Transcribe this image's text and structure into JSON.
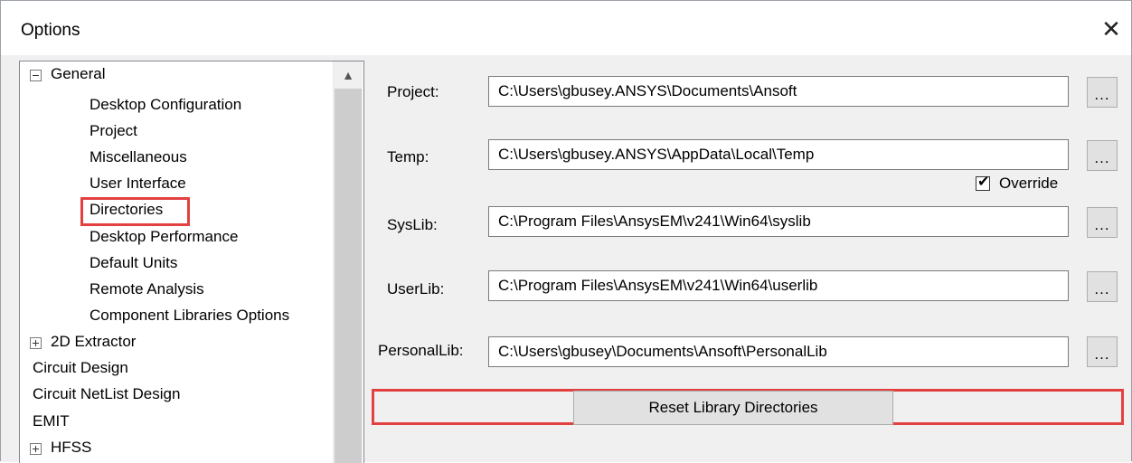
{
  "window": {
    "title": "Options"
  },
  "icons": {
    "close": "close-icon",
    "expand": "plus-box-icon",
    "collapse": "minus-box-icon",
    "scroll_up": "chevron-up-icon"
  },
  "tree": {
    "general": "General",
    "general_children": [
      "Desktop Configuration",
      "Project",
      "Miscellaneous",
      "User Interface",
      "Directories",
      "Desktop Performance",
      "Default Units",
      "Remote Analysis",
      "Component Libraries Options"
    ],
    "extractor_2d": "2D Extractor",
    "circuit_design": "Circuit Design",
    "circuit_netlist": "Circuit NetList Design",
    "emit": "EMIT",
    "hfss": "HFSS",
    "selected": "Directories"
  },
  "directories": {
    "project_label": "Project:",
    "project_value": "C:\\Users\\gbusey.ANSYS\\Documents\\Ansoft",
    "temp_label": "Temp:",
    "temp_value": "C:\\Users\\gbusey.ANSYS\\AppData\\Local\\Temp",
    "override_label": "Override",
    "override_checked": true,
    "syslib_label": "SysLib:",
    "syslib_value": "C:\\Program Files\\AnsysEM\\v241\\Win64\\syslib",
    "userlib_label": "UserLib:",
    "userlib_value": "C:\\Program Files\\AnsysEM\\v241\\Win64\\userlib",
    "personallib_label": "PersonalLib:",
    "personallib_value": "C:\\Users\\gbusey\\Documents\\Ansoft\\PersonalLib",
    "browse_label": "...",
    "reset_label": "Reset Library Directories"
  },
  "colors": {
    "highlight": "#e34040",
    "panel": "#f0f0f0"
  }
}
